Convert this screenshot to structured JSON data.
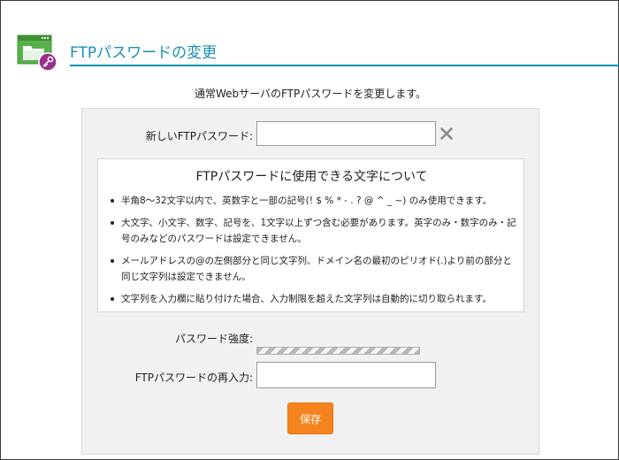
{
  "header": {
    "title": "FTPパスワードの変更",
    "icon": "folder-key-icon",
    "accent_color": "#1a8fb5"
  },
  "intro": "通常WebサーバのFTPパスワードを変更します。",
  "form": {
    "new_password_label": "新しいFTPパスワード:",
    "new_password_value": "",
    "clear_icon": "close-icon",
    "info": {
      "title": "FTPパスワードに使用できる文字について",
      "items": [
        "半角8～32文字以内で、英数字と一部の記号(! $ % * - . ? @ ^ _ ~) のみ使用できます。",
        "大文字、小文字、数字、記号を、1文字以上ずつ含む必要があります。英字のみ・数字のみ・記号のみなどのパスワードは設定できません。",
        "メールアドレスの@の左側部分と同じ文字列、ドメイン名の最初のピリオド(.)より前の部分と同じ文字列は設定できません。",
        "文字列を入力欄に貼り付けた場合、入力制限を超えた文字列は自動的に切り取られます。"
      ]
    },
    "strength_label": "パスワード強度:",
    "confirm_label": "FTPパスワードの再入力:",
    "confirm_value": "",
    "save_label": "保存",
    "save_color": "#f5841f"
  }
}
